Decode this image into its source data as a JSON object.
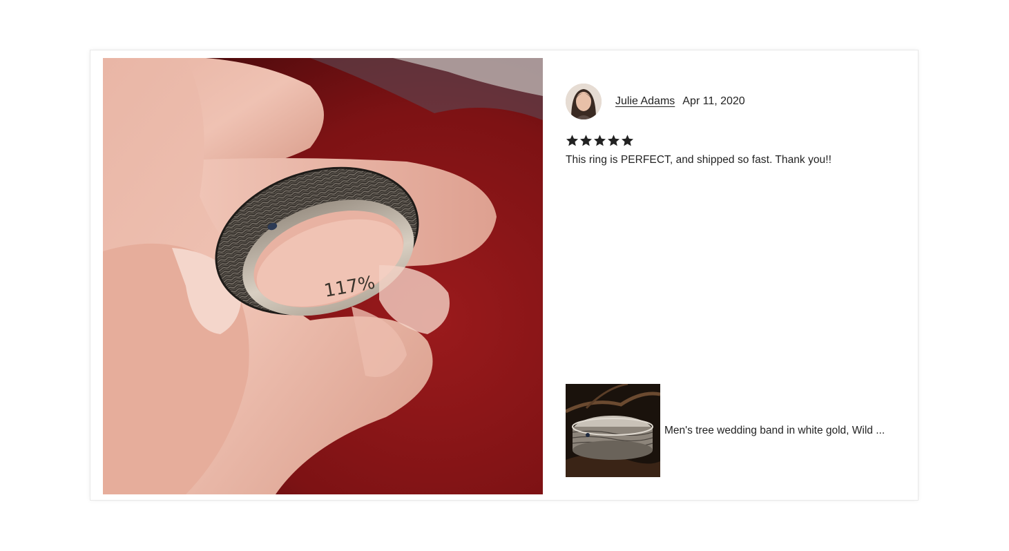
{
  "review": {
    "reviewer_name": "Julie Adams",
    "date": "Apr 11, 2020",
    "rating": 5,
    "rating_max": 5,
    "text": "This ring is PERFECT, and shipped so fast. Thank you!!",
    "photo_engraving": "117%"
  },
  "item": {
    "title": "Men's tree wedding band in white gold, Wild ..."
  },
  "icons": {
    "star": "star-icon",
    "avatar": "avatar"
  },
  "colors": {
    "text": "#222222",
    "star": "#222222",
    "border": "#e8e8e8",
    "background": "#ffffff"
  }
}
